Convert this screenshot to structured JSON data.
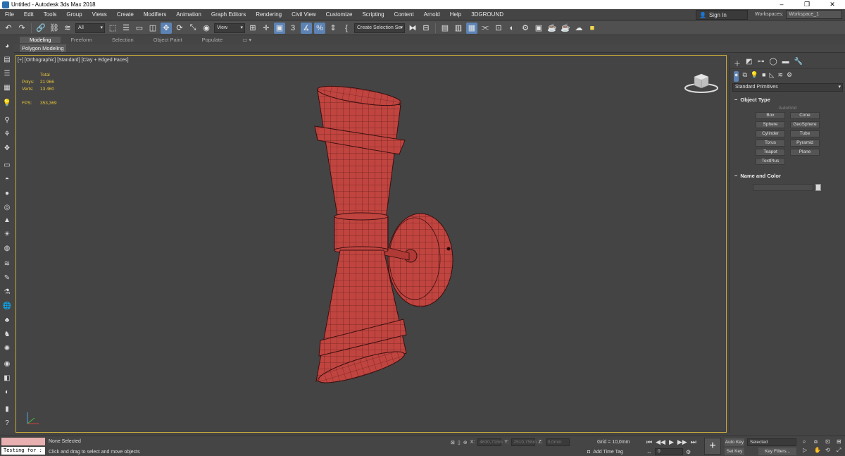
{
  "window": {
    "title": "Untitled - Autodesk 3ds Max 2018",
    "controls": [
      "–",
      "❐",
      "✕"
    ]
  },
  "menu": [
    "File",
    "Edit",
    "Tools",
    "Group",
    "Views",
    "Create",
    "Modifiers",
    "Animation",
    "Graph Editors",
    "Rendering",
    "Civil View",
    "Customize",
    "Scripting",
    "Content",
    "Arnold",
    "Help",
    "3DGROUND"
  ],
  "signin": {
    "label": "Sign In"
  },
  "workspaces": {
    "label": "Workspaces:",
    "value": "Workspace_1"
  },
  "toolbar": {
    "filter": "All",
    "view": "View",
    "selection_set": "Create Selection Se"
  },
  "ribbon": {
    "tabs": [
      "Modeling",
      "Freeform",
      "Selection",
      "Object Paint",
      "Populate"
    ],
    "active_tab": "Modeling",
    "panel_label": "Polygon Modeling"
  },
  "viewport": {
    "label": "[+] [Orthographic] [Standard] [Clay + Edged Faces]",
    "stats": {
      "header": "Total",
      "polys_label": "Polys:",
      "polys": "21 966",
      "verts_label": "Verts:",
      "verts": "13 460",
      "fps_label": "FPS:",
      "fps": "353,369"
    },
    "model_color": "#c0443f"
  },
  "command_panel": {
    "dropdown": "Standard Primitives",
    "object_type": {
      "title": "Object Type",
      "autogrid": "AutoGrid",
      "buttons": [
        "Box",
        "Cone",
        "Sphere",
        "GeoSphere",
        "Cylinder",
        "Tube",
        "Torus",
        "Pyramid",
        "Teapot",
        "Plane",
        "TextPlus"
      ]
    },
    "name_color": {
      "title": "Name and Color"
    }
  },
  "status": {
    "maxscript": "Testing for :",
    "selection": "None Selected",
    "prompt": "Click and drag to select and move objects",
    "x_label": "X:",
    "x": "4630,718m",
    "y_label": "Y:",
    "y": "2510,758m",
    "z_label": "Z:",
    "z": "0,0mm",
    "grid": "Grid = 10,0mm",
    "add_time_tag": "Add Time Tag",
    "frame": "0",
    "auto_key": "Auto Key",
    "set_key": "Set Key",
    "key_mode": "Selected",
    "key_filters": "Key Filters..."
  }
}
